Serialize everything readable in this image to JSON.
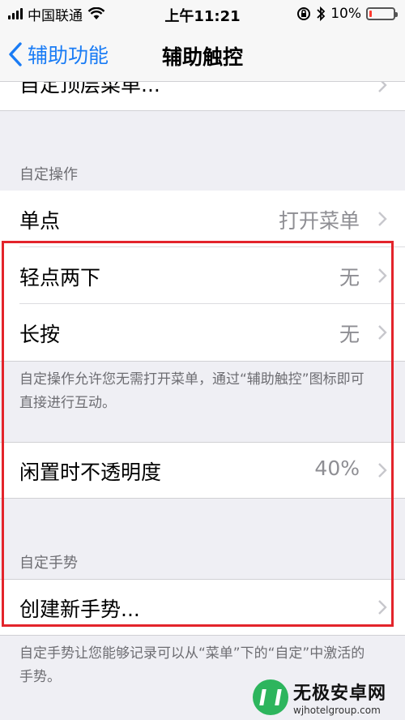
{
  "status_bar": {
    "carrier": "中国联通",
    "time": "上午11:21",
    "battery": "10%",
    "battery_level": 0.1,
    "icons": [
      "signal-icon",
      "wifi-icon",
      "rotation-lock-icon",
      "bluetooth-icon",
      "battery-icon"
    ]
  },
  "nav": {
    "back_label": "辅助功能",
    "title": "辅助触控"
  },
  "top_row": {
    "label": "自定顶层菜单..."
  },
  "custom_actions": {
    "header": "自定操作",
    "rows": [
      {
        "label": "单点",
        "value": "打开菜单"
      },
      {
        "label": "轻点两下",
        "value": "无"
      },
      {
        "label": "长按",
        "value": "无"
      }
    ],
    "footer": "自定操作允许您无需打开菜单，通过“辅助触控”图标即可直接进行互动。"
  },
  "opacity_row": {
    "label": "闲置时不透明度",
    "value": "40%"
  },
  "custom_gestures": {
    "header": "自定手势",
    "create_label": "创建新手势...",
    "footer": "自定手势让您能够记录可以从“菜单”下的“自定”中激活的手势。"
  },
  "watermark": {
    "main": "无极安卓网",
    "sub": "wjhotelgroup.com"
  },
  "colors": {
    "accent": "#1a7cf5",
    "highlight": "#e3242b",
    "battery_low": "#ff3b30"
  }
}
